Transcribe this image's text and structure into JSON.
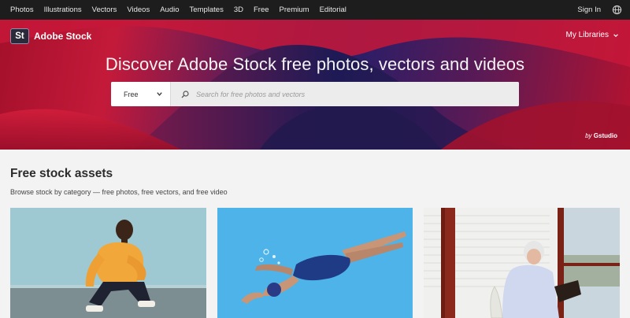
{
  "topnav": {
    "links": [
      "Photos",
      "Illustrations",
      "Vectors",
      "Videos",
      "Audio",
      "Templates",
      "3D",
      "Free",
      "Premium",
      "Editorial"
    ],
    "sign_in": "Sign In",
    "globe_icon": "globe-icon"
  },
  "hero": {
    "logo_mark": "St",
    "brand": "Adobe Stock",
    "my_libraries": "My Libraries",
    "headline": "Discover Adobe Stock free photos, vectors and videos",
    "search": {
      "filter_value": "Free",
      "placeholder": "Search for free photos and vectors",
      "value": ""
    },
    "credit_prefix": "by",
    "credit_name": "Gstudio"
  },
  "section": {
    "title": "Free stock assets",
    "subtitle": "Browse stock by category — free photos, free vectors, and free video"
  },
  "cards": [
    {
      "kind": "photo"
    },
    {
      "kind": "vector"
    },
    {
      "kind": "photo"
    }
  ],
  "colors": {
    "nav_bg": "#1d1d1d",
    "hero_red": "#b5122f",
    "hero_purple": "#2a1e68",
    "page_bg": "#f3f3f3"
  }
}
